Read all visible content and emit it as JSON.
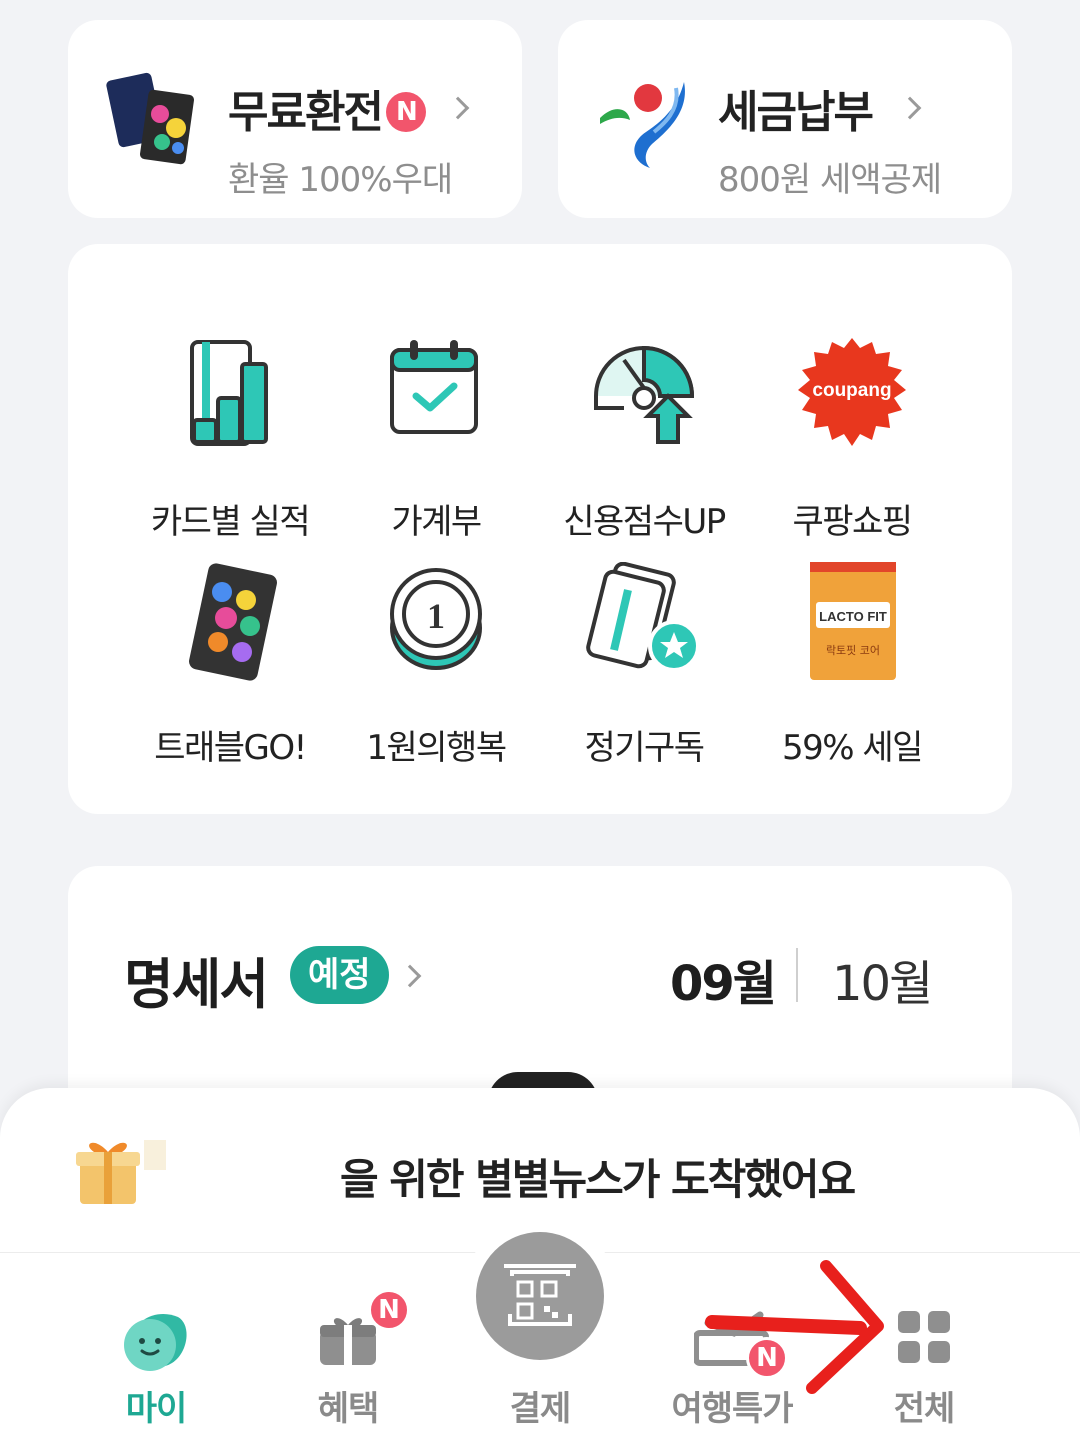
{
  "promo": {
    "exchange": {
      "title": "무료환전",
      "badge": "N",
      "subtitle": "환율 100%우대"
    },
    "tax": {
      "title": "세금납부",
      "subtitle": "800원 세액공제"
    }
  },
  "menu": {
    "items": [
      {
        "label": "카드별 실적",
        "icon": "card-performance-chart-icon"
      },
      {
        "label": "가계부",
        "icon": "calendar-check-icon"
      },
      {
        "label": "신용점수UP",
        "icon": "credit-gauge-up-icon"
      },
      {
        "label": "쿠팡쇼핑",
        "icon": "coupang-logo-icon",
        "logo_text": "coupang"
      },
      {
        "label": "트래블GO!",
        "icon": "travel-card-icon"
      },
      {
        "label": "1원의행복",
        "icon": "coin-icon",
        "coin_text": "1"
      },
      {
        "label": "정기구독",
        "icon": "subscription-cards-star-icon"
      },
      {
        "label": "59% 세일",
        "icon": "lactofit-product-icon",
        "product_text": "LACTO FIT",
        "product_sub": "락토핏 코어"
      }
    ]
  },
  "statement": {
    "title": "명세서",
    "badge": "예정",
    "months": [
      "09월",
      "10월"
    ],
    "selected_month": "09월"
  },
  "sheet": {
    "message": "을 위한 별별뉴스가 도착했어요"
  },
  "nav": {
    "items": [
      {
        "label": "마이",
        "active": true
      },
      {
        "label": "혜택",
        "badge": "N"
      },
      {
        "label": "결제"
      },
      {
        "label": "여행특가",
        "badge": "N"
      },
      {
        "label": "전체"
      }
    ]
  },
  "colors": {
    "accent": "#1ea893",
    "badge_red": "#f2556c",
    "annotation_arrow": "#e8201c"
  }
}
